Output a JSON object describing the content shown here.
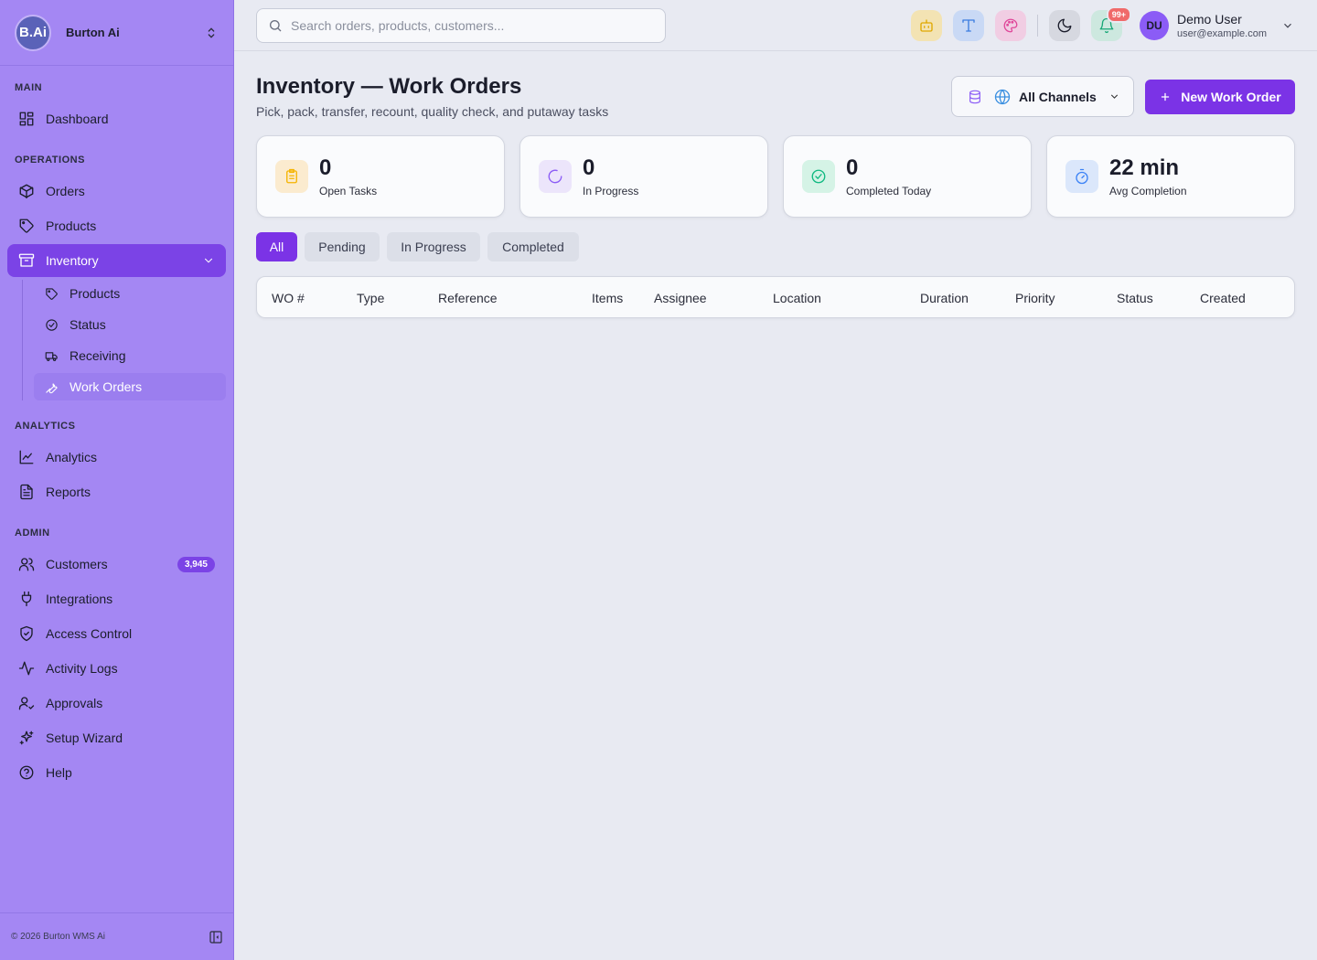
{
  "brand": {
    "logo_text": "B.Ai",
    "name": "Burton Ai"
  },
  "sidebar": {
    "sections": {
      "main": "MAIN",
      "operations": "OPERATIONS",
      "analytics": "ANALYTICS",
      "admin": "ADMIN"
    },
    "items": {
      "dashboard": "Dashboard",
      "orders": "Orders",
      "products": "Products",
      "inventory": "Inventory",
      "analytics": "Analytics",
      "reports": "Reports",
      "customers": "Customers",
      "customers_badge": "3,945",
      "integrations": "Integrations",
      "access_control": "Access Control",
      "activity_logs": "Activity Logs",
      "approvals": "Approvals",
      "setup_wizard": "Setup Wizard",
      "help": "Help"
    },
    "inventory_sub": {
      "products": "Products",
      "status": "Status",
      "receiving": "Receiving",
      "work_orders": "Work Orders"
    },
    "footer": "© 2026 Burton WMS Ai"
  },
  "topbar": {
    "search_placeholder": "Search orders, products, customers...",
    "notif_badge": "99+",
    "user": {
      "initials": "DU",
      "name": "Demo User",
      "email": "user@example.com"
    }
  },
  "page": {
    "title": "Inventory — Work Orders",
    "subtitle": "Pick, pack, transfer, recount, quality check, and putaway tasks",
    "channel": "All Channels",
    "new_button": "New Work Order"
  },
  "stats": [
    {
      "value": "0",
      "label": "Open Tasks",
      "color": "#f5b400"
    },
    {
      "value": "0",
      "label": "In Progress",
      "color": "#8b5cf6"
    },
    {
      "value": "0",
      "label": "Completed Today",
      "color": "#10b981"
    },
    {
      "value": "22 min",
      "label": "Avg Completion",
      "color": "#3b82f6"
    }
  ],
  "filters": [
    "All",
    "Pending",
    "In Progress",
    "Completed"
  ],
  "table": {
    "columns": [
      "WO #",
      "Type",
      "Reference",
      "Items",
      "Assignee",
      "Location",
      "Duration",
      "Priority",
      "Status",
      "Created"
    ]
  },
  "colors": {
    "accent": "#7b33e6",
    "sidebar": "#a487f3"
  }
}
